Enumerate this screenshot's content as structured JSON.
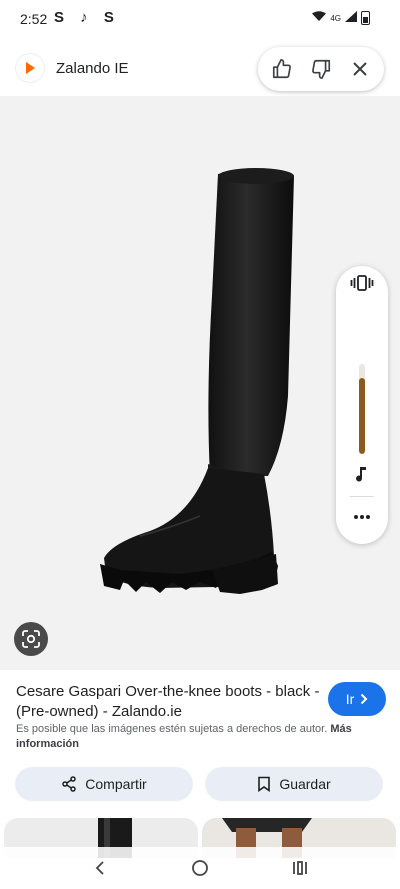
{
  "status_bar": {
    "time": "2:52",
    "apps": "S ♪ S",
    "signal": "4G"
  },
  "header": {
    "site_name": "Zalando IE",
    "brand_color": "#ff6900"
  },
  "icons": {
    "thumbs_up": "thumbs-up-icon",
    "thumbs_down": "thumbs-down-icon",
    "close": "close-icon",
    "vibrate": "vibrate-icon",
    "music": "music-note-icon",
    "more": "more-icon",
    "lens": "lens-icon"
  },
  "volume": {
    "level": 0.85
  },
  "result": {
    "title": "Cesare Gaspari Over-the-knee boots - black - (Pre-owned) - Zalando.ie",
    "visit_label": "Ir",
    "copyright": "Es posible que las imágenes estén sujetas a derechos de autor.",
    "more_info": "Más información"
  },
  "actions": {
    "share_label": "Compartir",
    "save_label": "Guardar"
  },
  "colors": {
    "accent": "#1a73e8",
    "button_bg": "#e9eef6"
  }
}
